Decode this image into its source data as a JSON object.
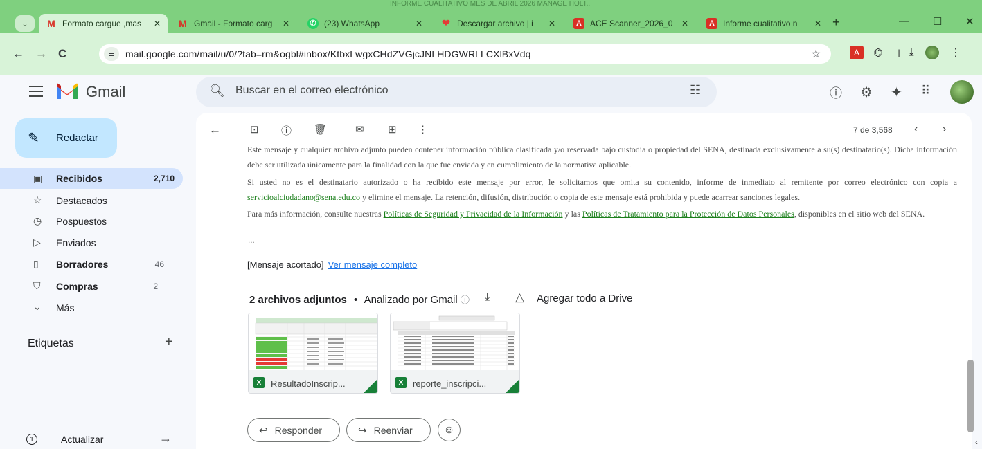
{
  "browser": {
    "window_title": "INFORME CUALITATIVO MES DE ABRIL 2026 MANAGE HOLT...",
    "tabs": [
      {
        "title": "Formato cargue ,mas",
        "favicon": "gmail-icon",
        "active": true
      },
      {
        "title": "Gmail - Formato carg",
        "favicon": "gmail-icon",
        "active": false
      },
      {
        "title": "(23) WhatsApp",
        "favicon": "whatsapp-icon",
        "active": false
      },
      {
        "title": "Descargar archivo | i",
        "favicon": "heart-icon",
        "active": false
      },
      {
        "title": "ACE Scanner_2026_0",
        "favicon": "pdf-icon",
        "active": false
      },
      {
        "title": "Informe cualitativo n",
        "favicon": "pdf-icon",
        "active": false
      }
    ],
    "url": "mail.google.com/mail/u/0/?tab=rm&ogbl#inbox/KtbxLwgxCHdZVGjcJNLHDGWRLLCXlBxVdq",
    "accent_color": "#7fd07f"
  },
  "gmail": {
    "brand": "Gmail",
    "search_placeholder": "Buscar en el correo electrónico",
    "compose_label": "Redactar",
    "nav": [
      {
        "label": "Recibidos",
        "count": "2,710",
        "bold": true,
        "active": true,
        "icon": "inbox-icon"
      },
      {
        "label": "Destacados",
        "count": "",
        "bold": false,
        "active": false,
        "icon": "star-icon"
      },
      {
        "label": "Pospuestos",
        "count": "",
        "bold": false,
        "active": false,
        "icon": "clock-icon"
      },
      {
        "label": "Enviados",
        "count": "",
        "bold": false,
        "active": false,
        "icon": "send-icon"
      },
      {
        "label": "Borradores",
        "count": "46",
        "bold": true,
        "active": false,
        "icon": "draft-icon"
      },
      {
        "label": "Compras",
        "count": "2",
        "bold": true,
        "active": false,
        "icon": "shopping-icon"
      },
      {
        "label": "Más",
        "count": "",
        "bold": false,
        "active": false,
        "icon": "chevron-down-icon"
      }
    ],
    "labels_title": "Etiquetas",
    "update_label": "Actualizar",
    "update_badge": "1"
  },
  "message": {
    "pager": "7 de 3,568",
    "para1": "Este mensaje y cualquier archivo adjunto pueden contener información pública clasificada y/o reservada bajo custodia o propiedad del SENA, destinada exclusivamente a su(s) destinatario(s). Dicha información debe ser utilizada únicamente para la finalidad con la que fue enviada y en cumplimiento de la normativa aplicable.",
    "para2_a": "Si usted no es el destinatario autorizado o ha recibido este mensaje por error, le solicitamos que omita su contenido, informe de inmediato al remitente por correo electrónico con copia a ",
    "para2_link": "servicioalciudadano@sena.edu.co",
    "para2_b": " y elimine el mensaje. La retención, difusión, distribución o copia de este mensaje está prohibida y puede acarrear sanciones legales.",
    "para3_a": "Para más información, consulte nuestras ",
    "para3_link1": "Políticas de Seguridad y Privacidad de la Información",
    "para3_mid": " y las ",
    "para3_link2": "Políticas de Tratamiento para la Protección de Datos Personales",
    "para3_b": ", disponibles en el sitio web del SENA.",
    "dots": "...",
    "shortened": "[Mensaje acortado]",
    "view_full": "Ver mensaje completo",
    "attachments_count": "2 archivos adjuntos",
    "attachments_sep": "•",
    "attachments_scan": "Analizado por Gmail",
    "add_to_drive": "Agregar todo a Drive",
    "attachments": [
      {
        "name": "ResultadoInscrip...",
        "type": "xls"
      },
      {
        "name": "reporte_inscripci...",
        "type": "xls"
      }
    ],
    "reply_label": "Responder",
    "forward_label": "Reenviar"
  }
}
